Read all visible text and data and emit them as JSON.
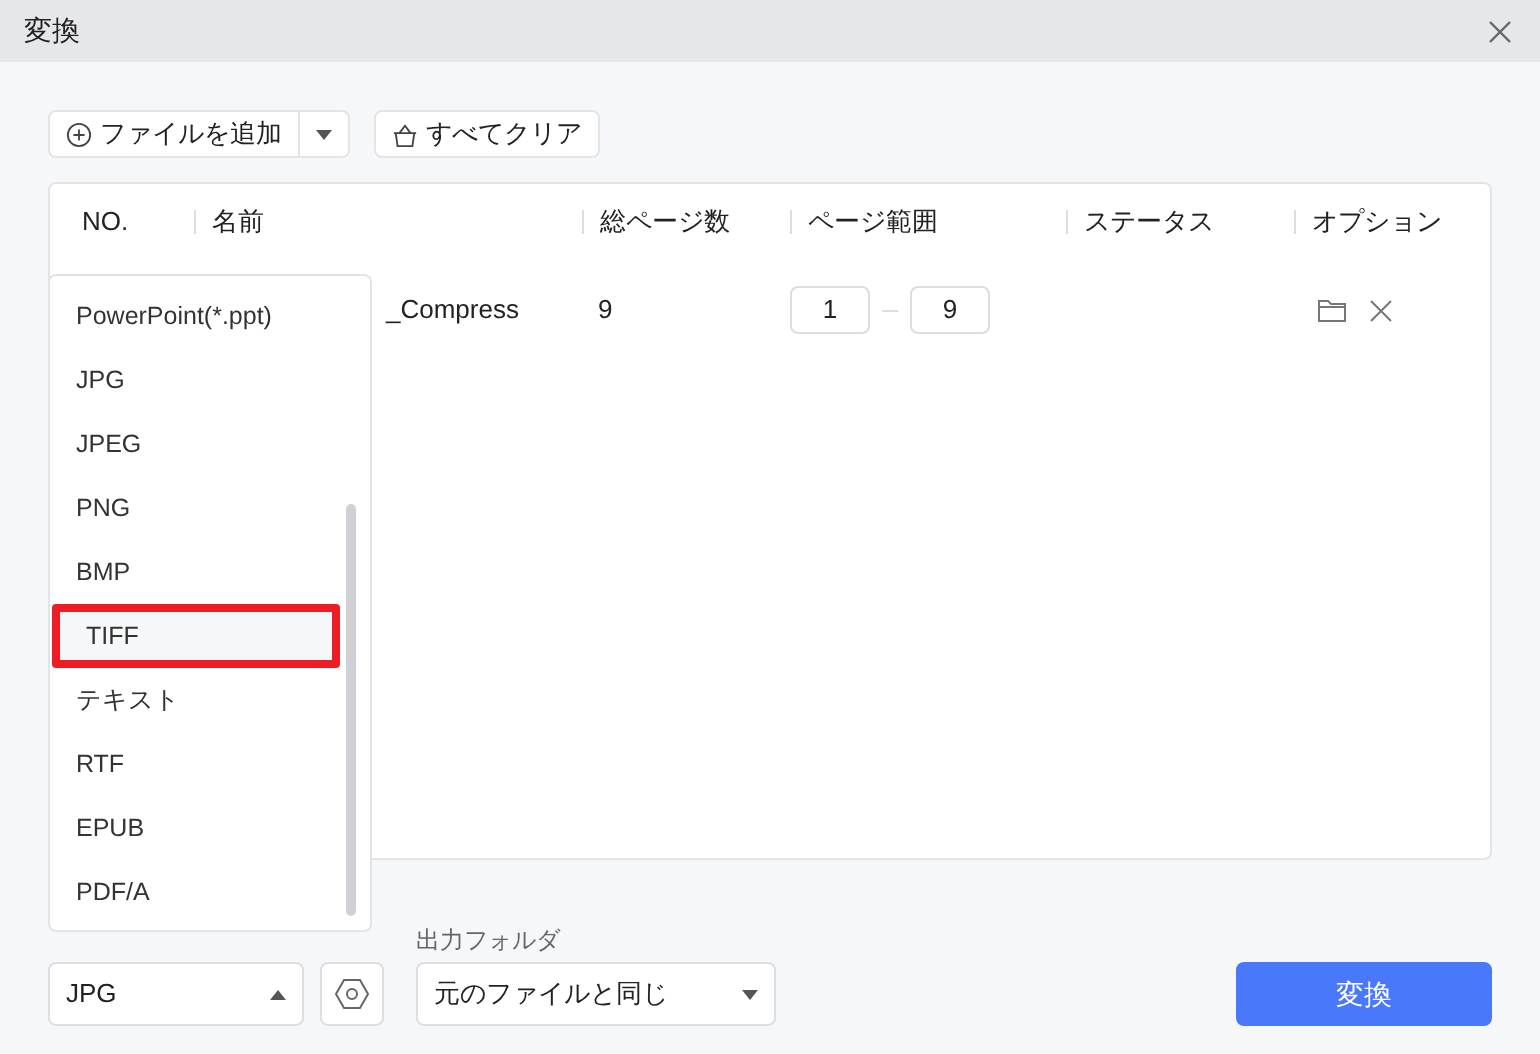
{
  "window": {
    "title": "変換"
  },
  "toolbar": {
    "add_button": "ファイルを追加",
    "clear_button": "すべてクリア"
  },
  "table": {
    "columns": [
      "NO.",
      "名前",
      "総ページ数",
      "ページ範囲",
      "ステータス",
      "オプション"
    ],
    "rows": [
      {
        "name": "_Compress",
        "pages": "9",
        "range_from": "1",
        "range_to": "9"
      }
    ]
  },
  "format_menu": {
    "items": [
      {
        "label": "PowerPoint(*.ppt)",
        "highlighted": false
      },
      {
        "label": "JPG",
        "highlighted": false
      },
      {
        "label": "JPEG",
        "highlighted": false
      },
      {
        "label": "PNG",
        "highlighted": false
      },
      {
        "label": "BMP",
        "highlighted": false
      },
      {
        "label": "TIFF",
        "highlighted": true
      },
      {
        "label": "テキスト",
        "highlighted": false
      },
      {
        "label": "RTF",
        "highlighted": false
      },
      {
        "label": "EPUB",
        "highlighted": false
      },
      {
        "label": "PDF/A",
        "highlighted": false
      }
    ]
  },
  "format_select": {
    "value": "JPG",
    "expanded": true
  },
  "output_folder": {
    "label": "出力フォルダ",
    "value": "元のファイルと同じ"
  },
  "convert_button": "変換"
}
